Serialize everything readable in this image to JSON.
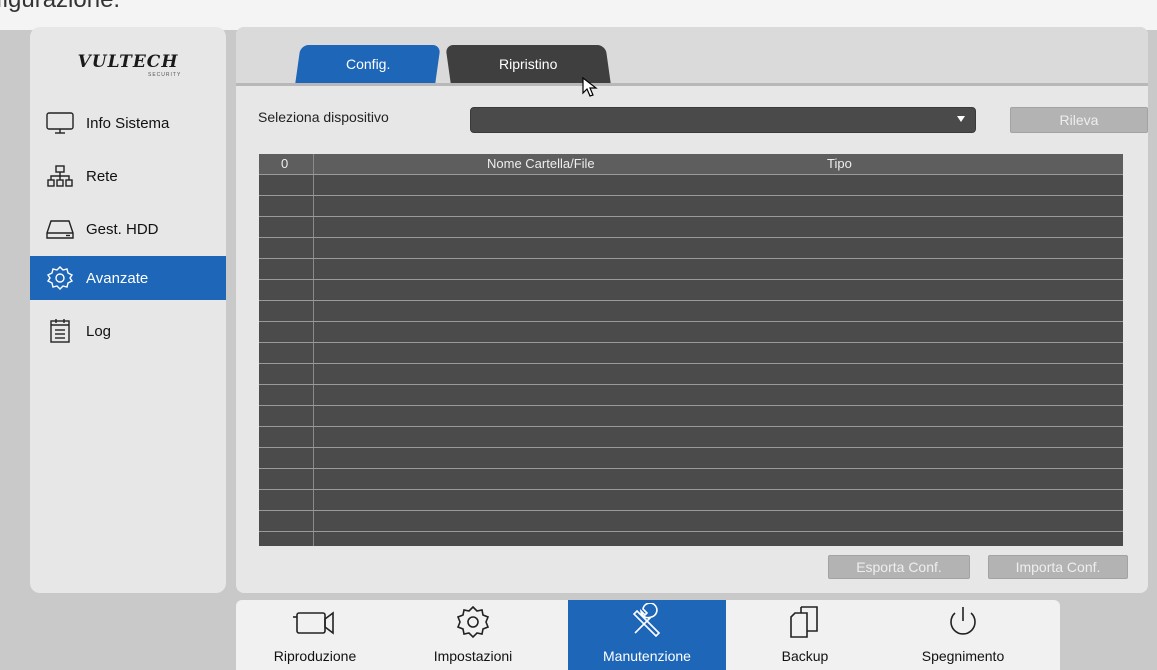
{
  "top_text": "figurazione.",
  "brand": {
    "logo": "VULTECH",
    "sub": "SECURITY"
  },
  "sidebar": {
    "items": [
      {
        "label": "Info Sistema",
        "icon": "monitor-icon"
      },
      {
        "label": "Rete",
        "icon": "network-icon"
      },
      {
        "label": "Gest. HDD",
        "icon": "hdd-icon"
      },
      {
        "label": "Avanzate",
        "icon": "gear-icon",
        "active": true
      },
      {
        "label": "Log",
        "icon": "log-icon"
      }
    ]
  },
  "tabs": [
    {
      "label": "Config.",
      "active": true
    },
    {
      "label": "Ripristino",
      "active": false
    }
  ],
  "device": {
    "label": "Seleziona dispositivo",
    "selected": "",
    "detect_button": "Rileva"
  },
  "table": {
    "columns": [
      "0",
      "Nome Cartella/File",
      "Tipo"
    ],
    "rows": []
  },
  "actions": {
    "export": "Esporta Conf.",
    "import": "Importa Conf."
  },
  "dock": {
    "items": [
      {
        "label": "Riproduzione",
        "icon": "camera-icon"
      },
      {
        "label": "Impostazioni",
        "icon": "gear-icon"
      },
      {
        "label": "Manutenzione",
        "icon": "tools-icon",
        "active": true
      },
      {
        "label": "Backup",
        "icon": "copy-icon"
      },
      {
        "label": "Spegnimento",
        "icon": "power-icon"
      }
    ]
  },
  "colors": {
    "accent": "#1d66b8",
    "panel": "#e7e7e7",
    "table": "#4b4b4b"
  }
}
